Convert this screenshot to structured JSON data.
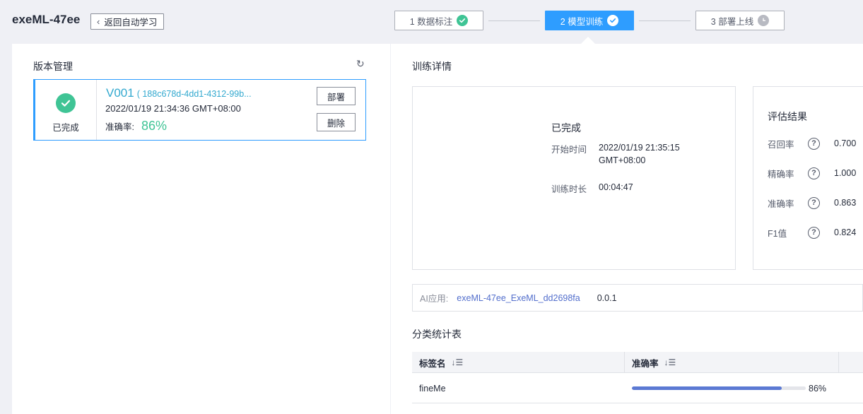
{
  "header": {
    "app_title": "exeML-47ee",
    "back_label": "返回自动学习"
  },
  "steps": [
    {
      "label": "1 数据标注",
      "state": "done"
    },
    {
      "label": "2 模型训练",
      "state": "active"
    },
    {
      "label": "3 部署上线",
      "state": "pending"
    }
  ],
  "version_panel": {
    "title": "版本管理",
    "card": {
      "status": "已完成",
      "version": "V001",
      "version_id": "( 188c678d-4dd1-4312-99b...",
      "created": "2022/01/19 21:34:36 GMT+08:00",
      "accuracy_label": "准确率:",
      "accuracy_value": "86%",
      "deploy_label": "部署",
      "delete_label": "删除"
    }
  },
  "training": {
    "title": "训练详情",
    "status": "已完成",
    "start_label": "开始时间",
    "start_line1": "2022/01/19 21:35:15",
    "start_line2": "GMT+08:00",
    "duration_label": "训练时长",
    "duration_value": "00:04:47"
  },
  "evaluation": {
    "title": "评估结果",
    "rows": [
      {
        "label": "召回率",
        "value": "0.700"
      },
      {
        "label": "精确率",
        "value": "1.000"
      },
      {
        "label": "准确率",
        "value": "0.863"
      },
      {
        "label": "F1值",
        "value": "0.824"
      }
    ]
  },
  "ai_app": {
    "label": "AI应用:",
    "name": "exeML-47ee_ExeML_dd2698fa",
    "version": "0.0.1"
  },
  "classification": {
    "title": "分类统计表",
    "columns": [
      "标签名",
      "准确率"
    ],
    "rows": [
      {
        "label": "fineMe",
        "accuracy": 0.86,
        "accuracy_text": "86%"
      }
    ]
  },
  "colors": {
    "primary": "#2e9dff",
    "success": "#3fc495",
    "link": "#526ecc",
    "bar": "#5b79d3"
  }
}
